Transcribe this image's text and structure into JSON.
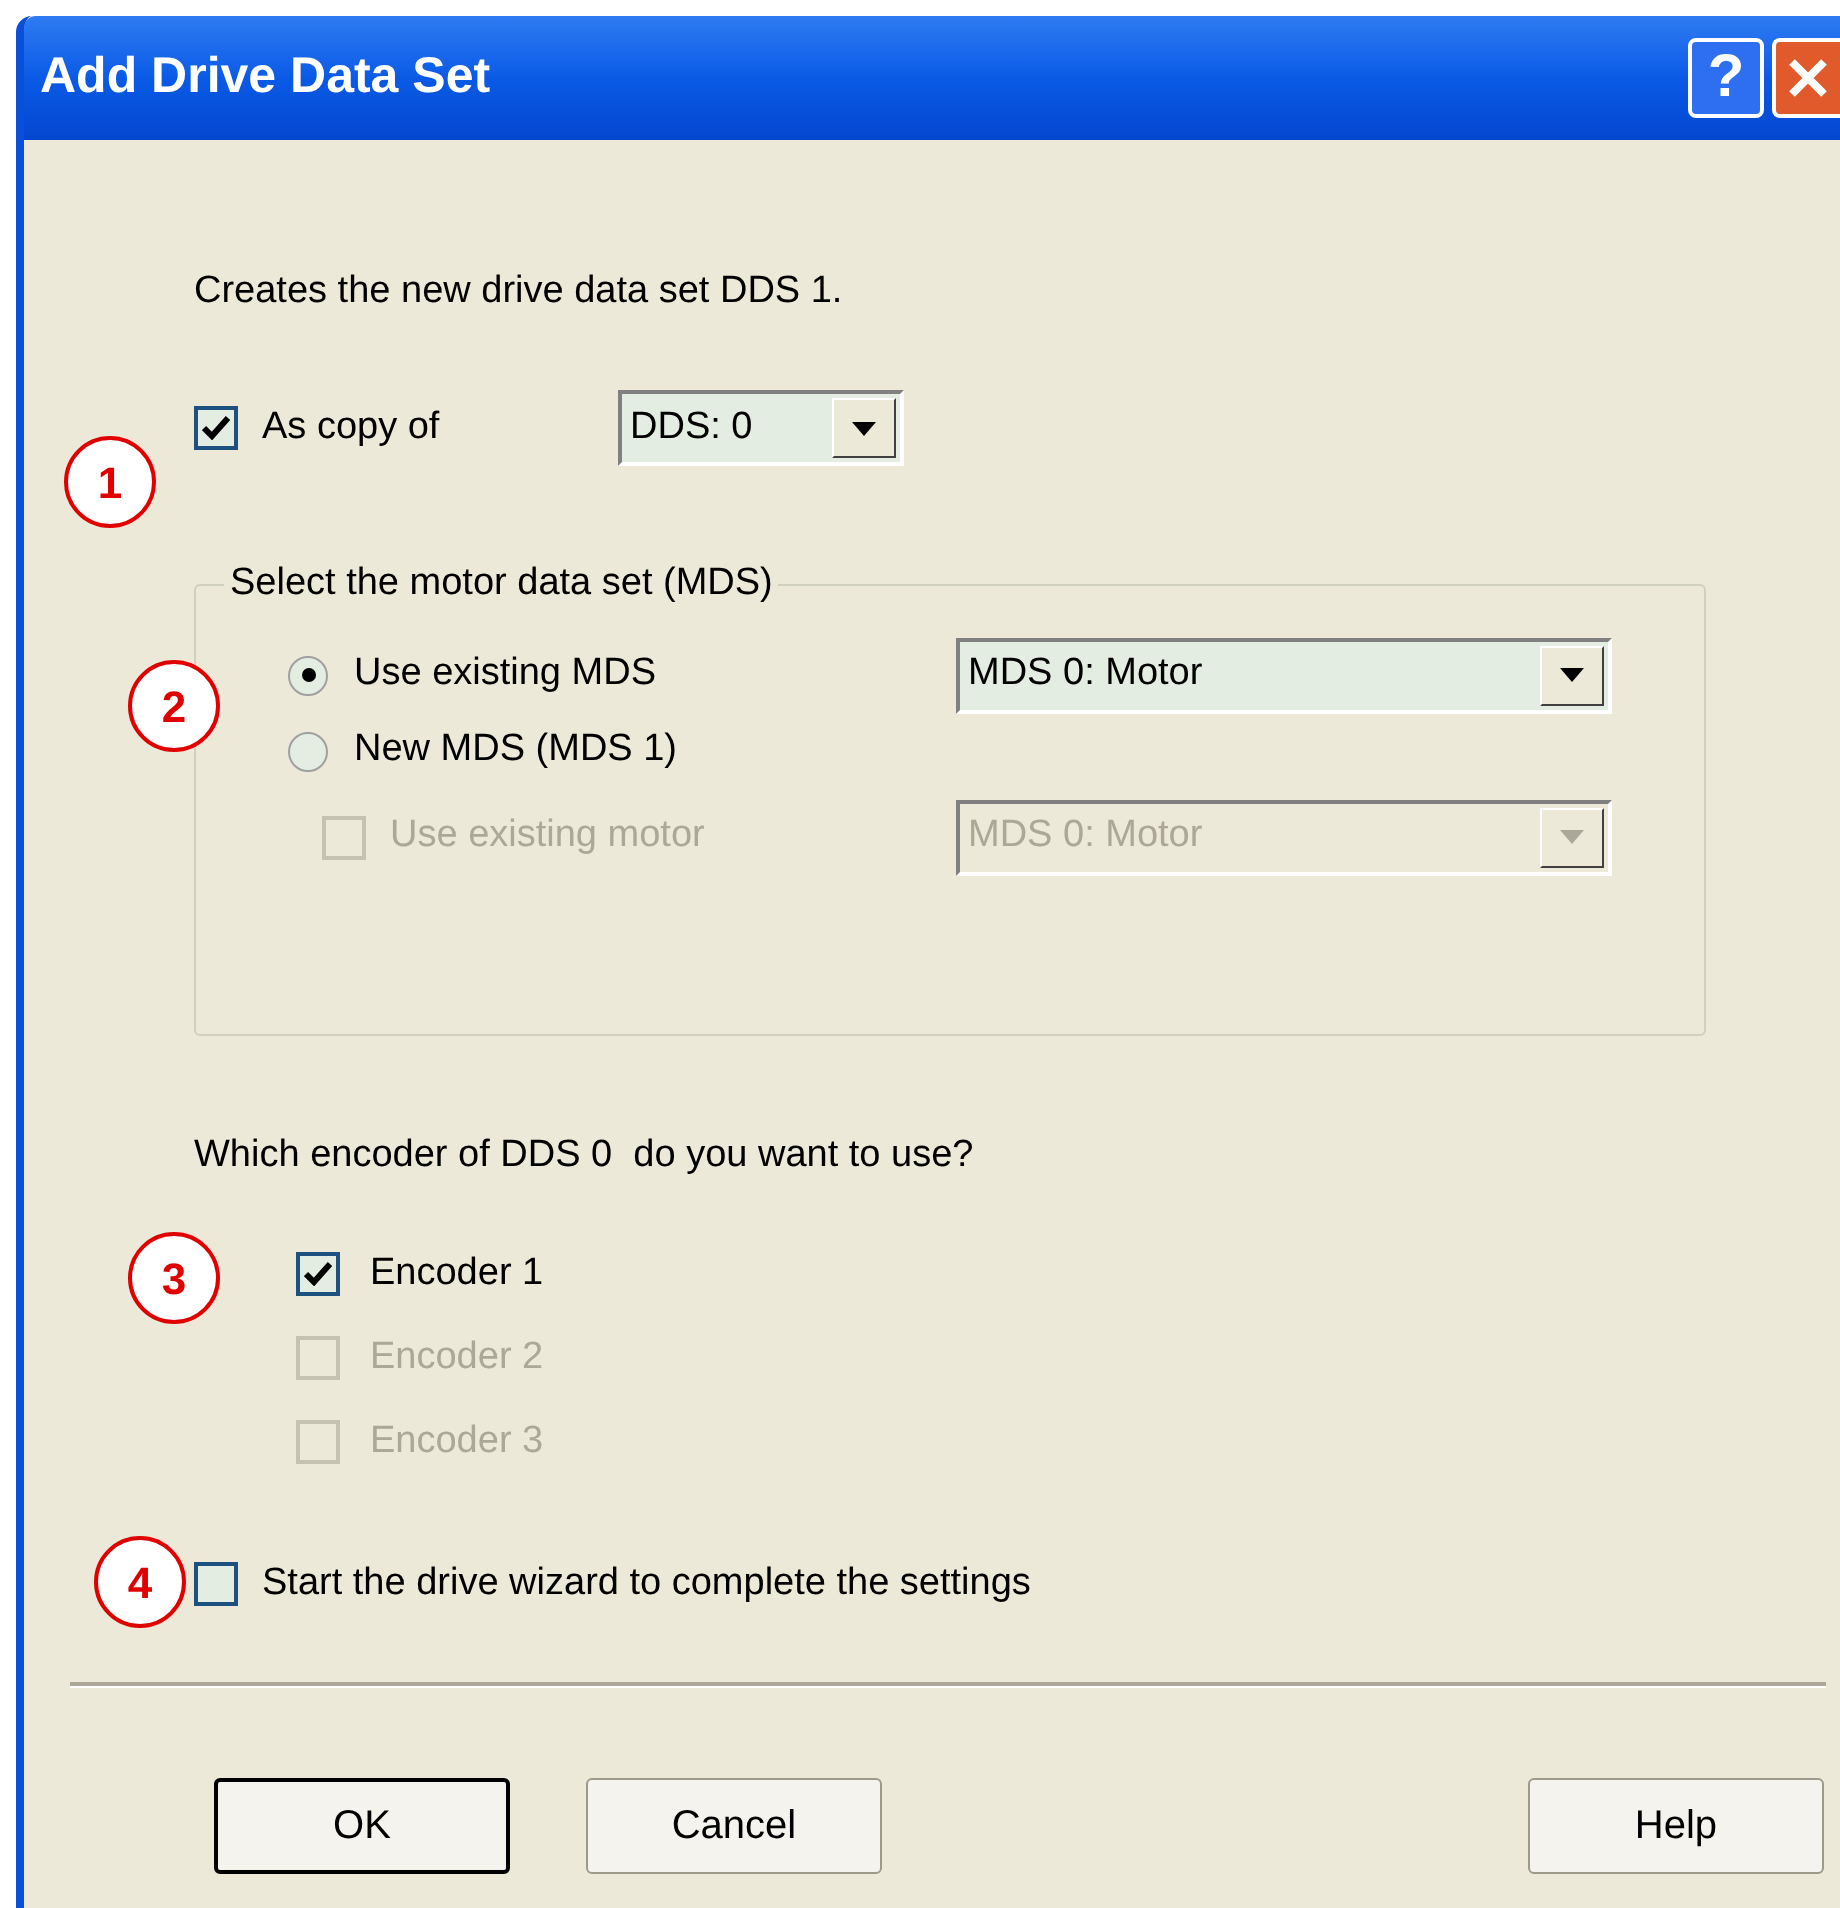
{
  "window": {
    "title": "Add Drive Data Set",
    "help_glyph": "?"
  },
  "intro": "Creates the new drive data set DDS 1.",
  "copy": {
    "label": "As copy of",
    "checked": true,
    "dropdown": "DDS: 0"
  },
  "motor_group": {
    "legend": "Select the motor data set (MDS)",
    "options": [
      {
        "label": "Use existing MDS",
        "selected": true
      },
      {
        "label": "New MDS (MDS 1)",
        "selected": false
      }
    ],
    "dropdown": "MDS 0: Motor",
    "existing_motor": {
      "label": "Use existing motor",
      "checked": false,
      "disabled": true,
      "dropdown": "MDS 0: Motor"
    }
  },
  "encoder_question": "Which encoder of DDS 0  do you want to use?",
  "encoders": [
    {
      "label": "Encoder 1",
      "checked": true,
      "disabled": false
    },
    {
      "label": "Encoder 2",
      "checked": false,
      "disabled": true
    },
    {
      "label": "Encoder 3",
      "checked": false,
      "disabled": true
    }
  ],
  "wizard": {
    "label": "Start the drive wizard to complete the settings",
    "checked": false
  },
  "buttons": [
    {
      "label": "OK",
      "default": true
    },
    {
      "label": "Cancel",
      "default": false
    },
    {
      "label": "Help",
      "default": false
    }
  ],
  "callouts": [
    "1",
    "2",
    "3",
    "4"
  ]
}
